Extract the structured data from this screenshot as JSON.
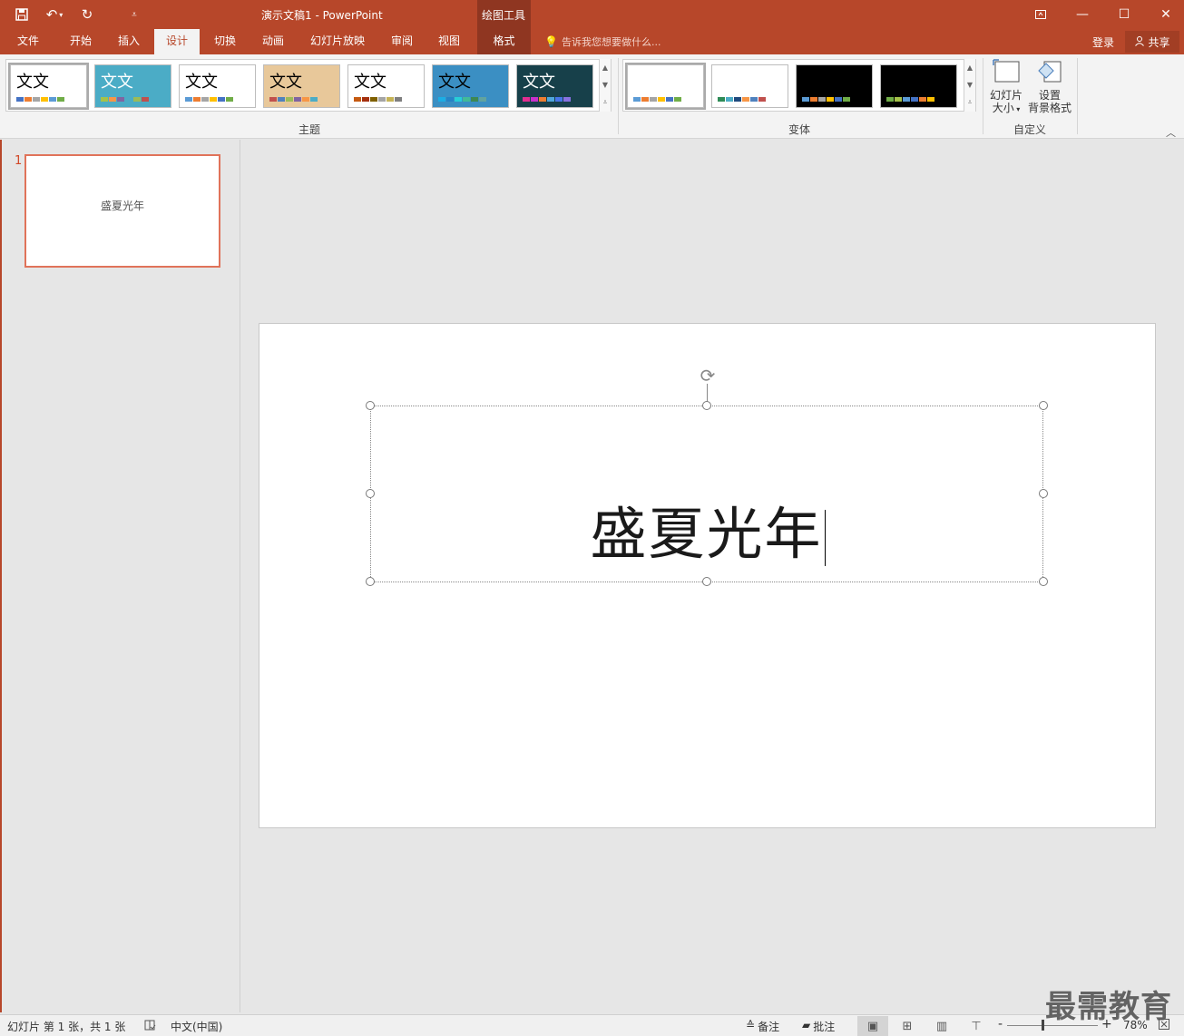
{
  "titlebar": {
    "title": "演示文稿1 - PowerPoint",
    "contextual_group": "绘图工具"
  },
  "tabs": {
    "file": "文件",
    "home": "开始",
    "insert": "插入",
    "design": "设计",
    "transitions": "切换",
    "animations": "动画",
    "slideshow": "幻灯片放映",
    "review": "审阅",
    "view": "视图",
    "format": "格式",
    "tellme": "告诉我您想要做什么...",
    "login": "登录",
    "share": "共享"
  },
  "ribbon": {
    "themes_label": "主题",
    "variants_label": "变体",
    "customize_label": "自定义",
    "slide_size_line1": "幻灯片",
    "slide_size_line2": "大小",
    "bg_format_line1": "设置",
    "bg_format_line2": "背景格式",
    "theme_sample_text": "文文",
    "themes": [
      {
        "bg": "#ffffff",
        "fg": "#000000",
        "swatches": [
          "#4472c4",
          "#ed7d31",
          "#a5a5a5",
          "#ffc000",
          "#5b9bd5",
          "#70ad47"
        ]
      },
      {
        "bg": "#4bacc6",
        "fg": "#ffffff",
        "swatches": [
          "#a5c249",
          "#f79646",
          "#8064a2",
          "#4bacc6",
          "#9bbb59",
          "#c0504d"
        ]
      },
      {
        "bg": "#ffffff",
        "fg": "#000000",
        "swatches": [
          "#5b9bd5",
          "#ed7d31",
          "#a5a5a5",
          "#ffc000",
          "#4472c4",
          "#70ad47"
        ]
      },
      {
        "bg": "#e8c89a",
        "fg": "#000000",
        "swatches": [
          "#c0504d",
          "#4f81bd",
          "#9bbb59",
          "#8064a2",
          "#f79646",
          "#4bacc6"
        ]
      },
      {
        "bg": "#ffffff",
        "fg": "#000000",
        "swatches": [
          "#c55a11",
          "#a5300f",
          "#7f6000",
          "#a5a5a5",
          "#c5b356",
          "#7f7f7f"
        ]
      },
      {
        "bg": "#3b8fc3",
        "fg": "#000000",
        "swatches": [
          "#1cade4",
          "#2683c6",
          "#27ced7",
          "#42ba97",
          "#3e8853",
          "#62a39f"
        ]
      },
      {
        "bg": "#17404a",
        "fg": "#ffffff",
        "swatches": [
          "#e32d91",
          "#c830cc",
          "#ed7d31",
          "#4ea6dc",
          "#4775e7",
          "#8971e1"
        ]
      }
    ],
    "variants": [
      {
        "bg": "#ffffff",
        "swatches": [
          "#5b9bd5",
          "#ed7d31",
          "#a5a5a5",
          "#ffc000",
          "#4472c4",
          "#70ad47"
        ]
      },
      {
        "bg": "#ffffff",
        "swatches": [
          "#2e8b57",
          "#4bacc6",
          "#1f497d",
          "#f79646",
          "#4f81bd",
          "#c0504d"
        ]
      },
      {
        "bg": "#000000",
        "swatches": [
          "#5b9bd5",
          "#ed7d31",
          "#a5a5a5",
          "#ffc000",
          "#4472c4",
          "#70ad47"
        ]
      },
      {
        "bg": "#000000",
        "swatches": [
          "#70ad47",
          "#a5c249",
          "#5b9bd5",
          "#4472c4",
          "#ed7d31",
          "#ffc000"
        ]
      }
    ]
  },
  "thumbnail": {
    "number": "1",
    "text": "盛夏光年"
  },
  "slide": {
    "title": "盛夏光年"
  },
  "statusbar": {
    "slide_info": "幻灯片 第 1 张，共 1 张",
    "language": "中文(中国)",
    "notes": "备注",
    "comments": "批注",
    "zoom": "78%"
  },
  "watermark": "最需教育",
  "colors": {
    "accent": "#b7472a",
    "selection": "#e0735a"
  }
}
